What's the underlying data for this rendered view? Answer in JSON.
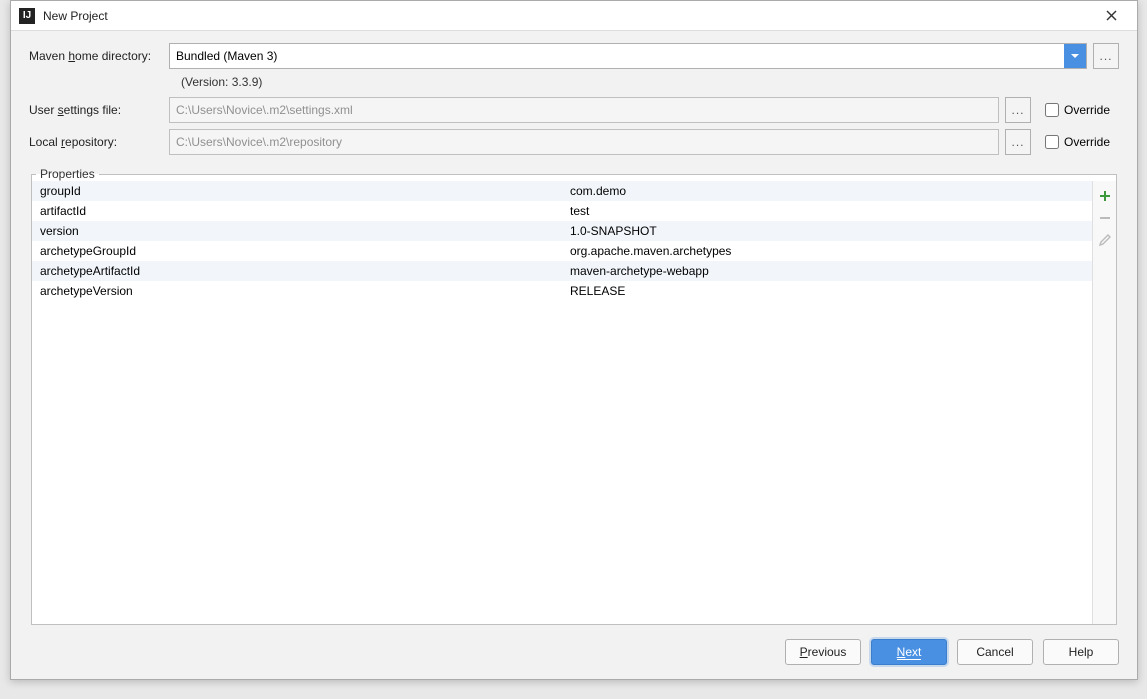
{
  "window": {
    "title": "New Project"
  },
  "form": {
    "mavenHome": {
      "label": "Maven home directory:",
      "value": "Bundled (Maven 3)"
    },
    "versionHint": "(Version: 3.3.9)",
    "userSettings": {
      "label": "User settings file:",
      "value": "C:\\Users\\Novice\\.m2\\settings.xml"
    },
    "localRepo": {
      "label": "Local repository:",
      "value": "C:\\Users\\Novice\\.m2\\repository"
    },
    "overrideLabel": "Override",
    "propertiesLegend": "Properties"
  },
  "properties": [
    {
      "key": "groupId",
      "value": "com.demo"
    },
    {
      "key": "artifactId",
      "value": "test"
    },
    {
      "key": "version",
      "value": "1.0-SNAPSHOT"
    },
    {
      "key": "archetypeGroupId",
      "value": "org.apache.maven.archetypes"
    },
    {
      "key": "archetypeArtifactId",
      "value": "maven-archetype-webapp"
    },
    {
      "key": "archetypeVersion",
      "value": "RELEASE"
    }
  ],
  "buttons": {
    "previous": "Previous",
    "next": "Next",
    "cancel": "Cancel",
    "help": "Help"
  }
}
